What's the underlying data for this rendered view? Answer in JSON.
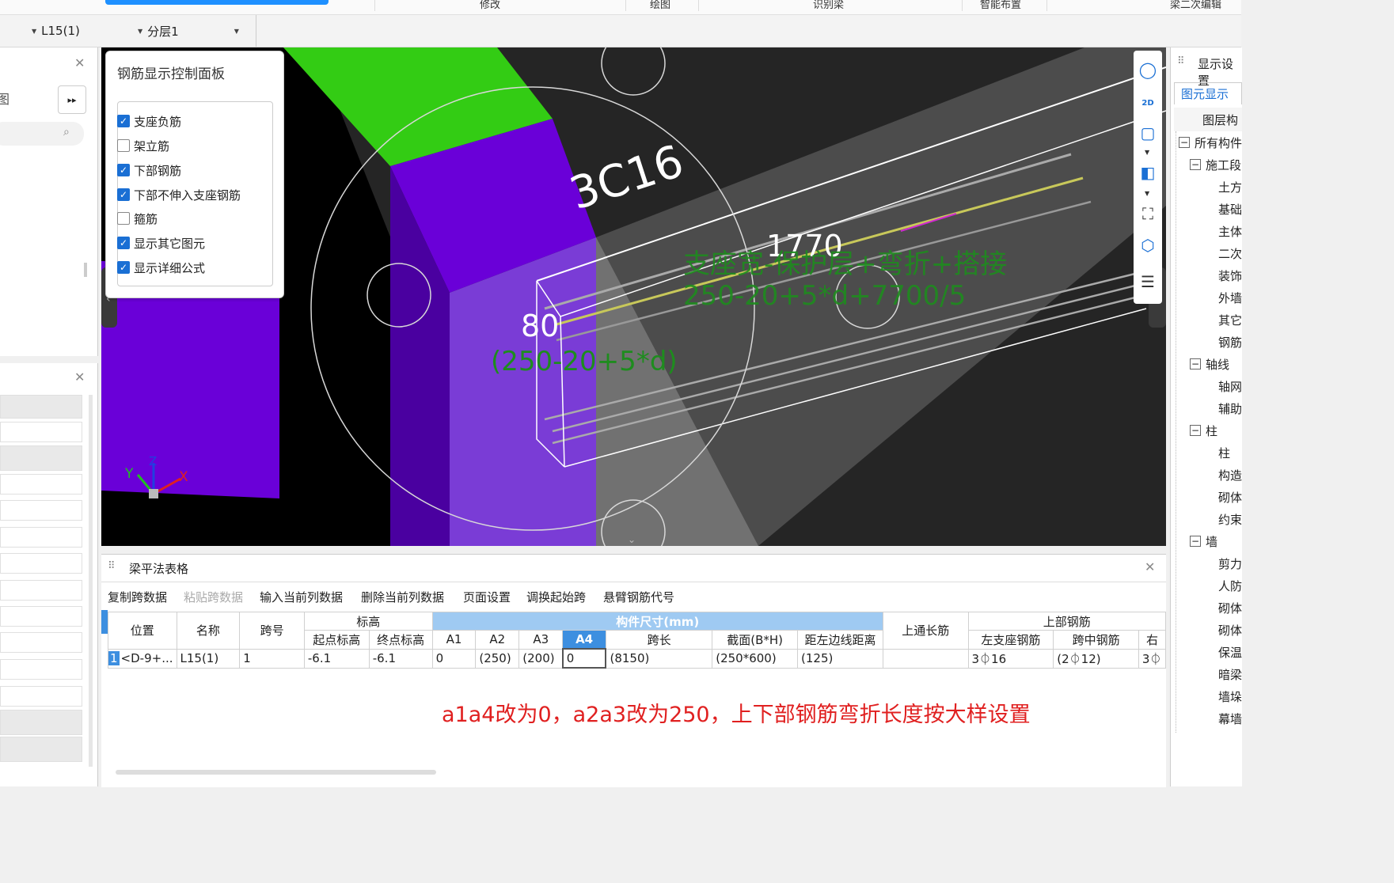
{
  "topbar": {
    "items": [
      "修改",
      "绘图",
      "识别梁",
      "智能布置",
      "梁二次编辑"
    ]
  },
  "layer_bar": {
    "component_select": "L15(1)",
    "layer_select": "分层1"
  },
  "viewport": {
    "rebar_label": "3C16",
    "dim_top": "1770",
    "formula_top_1": "支座宽-保护层+弯折+搭接",
    "formula_top_2": "250-20+5*d+7700/5",
    "dim_left": "80",
    "formula_left": "(250-20+5*d)",
    "axis_x": "X",
    "axis_y": "Y",
    "axis_z": "Z"
  },
  "rebar_panel": {
    "title": "钢筋显示控制面板",
    "options": [
      {
        "label": "支座负筋",
        "checked": true
      },
      {
        "label": "架立筋",
        "checked": false
      },
      {
        "label": "下部钢筋",
        "checked": true
      },
      {
        "label": "下部不伸入支座钢筋",
        "checked": true
      },
      {
        "label": "箍筋",
        "checked": false
      },
      {
        "label": "显示其它图元",
        "checked": true
      },
      {
        "label": "显示详细公式",
        "checked": true
      }
    ]
  },
  "right_panel": {
    "title": "显示设置",
    "tab": "图元显示",
    "header": "图层构",
    "tree": [
      "所有构件",
      "施工段",
      "土方",
      "基础",
      "主体",
      "二次",
      "装饰",
      "外墙",
      "其它",
      "钢筋",
      "轴线",
      "轴网",
      "辅助",
      "柱",
      "柱",
      "构造",
      "砌体",
      "约束",
      "墙",
      "剪力",
      "人防",
      "砌体",
      "砌体",
      "保温",
      "暗梁",
      "墙垛",
      "幕墙"
    ]
  },
  "beam_table": {
    "title": "梁平法表格",
    "toolbar": [
      "复制跨数据",
      "粘贴跨数据",
      "输入当前列数据",
      "删除当前列数据",
      "页面设置",
      "调换起始跨",
      "悬臂钢筋代号"
    ],
    "headers": {
      "pos": "位置",
      "name": "名称",
      "span": "跨号",
      "elev": "标高",
      "elev_start": "起点标高",
      "elev_end": "终点标高",
      "size": "构件尺寸(mm)",
      "a1": "A1",
      "a2": "A2",
      "a3": "A3",
      "a4": "A4",
      "span_len": "跨长",
      "section": "截面(B*H)",
      "edge": "距左边线距离",
      "top_through": "上通长筋",
      "top_rebar": "上部钢筋",
      "left_support": "左支座钢筋",
      "mid_span": "跨中钢筋",
      "right": "右"
    },
    "row": {
      "index": "1",
      "pos": "<D-9+...",
      "name": "L15(1)",
      "span": "1",
      "elev_start": "-6.1",
      "elev_end": "-6.1",
      "a1": "0",
      "a2": "(250)",
      "a3": "(200)",
      "a4": "0",
      "span_len": "(8150)",
      "section": "(250*600)",
      "edge": "(125)",
      "top_through": "",
      "left_support": "3⏀16",
      "mid_span": "(2⏀12)",
      "right": "3⏀"
    },
    "annotation": "a1a4改为0，a2a3改为250，上下部钢筋弯折长度按大样设置"
  },
  "colors": {
    "accent": "#1a6fd4",
    "beam_purple": "#6a00d8",
    "slab_green": "#33cc14",
    "formula_green": "#1e8c1e",
    "annotation_red": "#e02020",
    "header_blue": "#9fcaf2"
  }
}
